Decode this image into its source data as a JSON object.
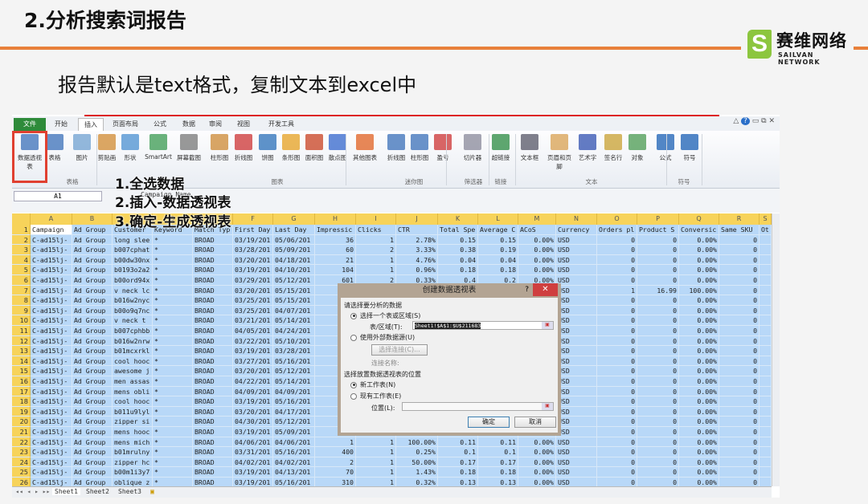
{
  "slide": {
    "title": "2.分析搜索词报告",
    "subtitle": "报告默认是text格式，复制文本到excel中",
    "logo_cn": "赛维网络",
    "logo_en": "SAILVAN NETWORK",
    "accent": "#e8803a"
  },
  "ribbon": {
    "tabs": [
      "文件",
      "开始",
      "插入",
      "页面布局",
      "公式",
      "数据",
      "审阅",
      "视图",
      "开发工具"
    ],
    "buttons": [
      "数据透视表",
      "表格",
      "图片",
      "剪贴画",
      "形状",
      "SmartArt",
      "屏幕截图",
      "柱形图",
      "折线图",
      "饼图",
      "条形图",
      "面积图",
      "散点图",
      "其他图表",
      "折线图",
      "柱形图",
      "盈亏",
      "切片器",
      "超链接",
      "文本框",
      "页眉和页脚",
      "艺术字",
      "签名行",
      "对象",
      "公式",
      "符号"
    ],
    "groups": [
      "表格",
      "图表",
      "迷你图",
      "筛选器",
      "链接",
      "文本",
      "符号"
    ]
  },
  "formula": {
    "name_box": "A1",
    "value": "Campaign Name"
  },
  "steps": [
    "1.全选数据",
    "2.插入-数据透视表",
    "3.确定-生成透视表"
  ],
  "columns": [
    "A",
    "B",
    "C",
    "D",
    "E",
    "F",
    "G",
    "H",
    "I",
    "J",
    "K",
    "L",
    "M",
    "N",
    "O",
    "P",
    "Q",
    "R",
    "S"
  ],
  "rows": [
    [
      "Campaign",
      "Ad Group",
      "Customer",
      "Keyword",
      "Match Typ",
      "First Day",
      "Last Day",
      "Impressic",
      "Clicks",
      "CTR",
      "Total Spe",
      "Average C",
      "ACoS",
      "Currency",
      "Orders pl",
      "Product S",
      "Conversic",
      "Same SKU",
      "Ot"
    ],
    [
      "C-ad15lj-",
      "Ad Group",
      "long slee",
      "*",
      "BROAD",
      "03/19/201",
      "05/06/201",
      "36",
      "1",
      "2.78%",
      "0.15",
      "0.15",
      "0.00%",
      "USD",
      "0",
      "0",
      "0.00%",
      "0",
      ""
    ],
    [
      "C-ad15lj-",
      "Ad Group",
      "b007cphat",
      "*",
      "BROAD",
      "03/28/201",
      "05/09/201",
      "60",
      "2",
      "3.33%",
      "0.38",
      "0.19",
      "0.00%",
      "USD",
      "0",
      "0",
      "0.00%",
      "0",
      ""
    ],
    [
      "C-ad15lj-",
      "Ad Group",
      "b00dw30nx",
      "*",
      "BROAD",
      "03/20/201",
      "04/18/201",
      "21",
      "1",
      "4.76%",
      "0.04",
      "0.04",
      "0.00%",
      "USD",
      "0",
      "0",
      "0.00%",
      "0",
      ""
    ],
    [
      "C-ad15lj-",
      "Ad Group",
      "b0193o2a2",
      "*",
      "BROAD",
      "03/19/201",
      "04/10/201",
      "104",
      "1",
      "0.96%",
      "0.18",
      "0.18",
      "0.00%",
      "USD",
      "0",
      "0",
      "0.00%",
      "0",
      ""
    ],
    [
      "C-ad15lj-",
      "Ad Group",
      "b00ord94x",
      "*",
      "BROAD",
      "03/29/201",
      "05/12/201",
      "601",
      "2",
      "0.33%",
      "0.4",
      "0.2",
      "0.00%",
      "USD",
      "0",
      "0",
      "0.00%",
      "0",
      ""
    ],
    [
      "C-ad15lj-",
      "Ad Group",
      "v neck lc",
      "*",
      "BROAD",
      "03/20/201",
      "05/15/201",
      "",
      "",
      "",
      "",
      "",
      "",
      "USD",
      "1",
      "16.99",
      "100.00%",
      "0",
      ""
    ],
    [
      "C-ad15lj-",
      "Ad Group",
      "b016w2nyc",
      "*",
      "BROAD",
      "03/25/201",
      "05/15/201",
      "",
      "",
      "",
      "",
      "",
      "",
      "USD",
      "0",
      "0",
      "0.00%",
      "0",
      ""
    ],
    [
      "C-ad15lj-",
      "Ad Group",
      "b00o9q7nc",
      "*",
      "BROAD",
      "03/25/201",
      "04/07/201",
      "",
      "",
      "",
      "",
      "",
      "",
      "USD",
      "0",
      "0",
      "0.00%",
      "0",
      ""
    ],
    [
      "C-ad15lj-",
      "Ad Group",
      "v neck t",
      "*",
      "BROAD",
      "03/21/201",
      "05/14/201",
      "",
      "",
      "",
      "",
      "",
      "",
      "USD",
      "0",
      "0",
      "0.00%",
      "0",
      ""
    ],
    [
      "C-ad15lj-",
      "Ad Group",
      "b007cphbb",
      "*",
      "BROAD",
      "04/05/201",
      "04/24/201",
      "",
      "",
      "",
      "",
      "",
      "",
      "USD",
      "0",
      "0",
      "0.00%",
      "0",
      ""
    ],
    [
      "C-ad15lj-",
      "Ad Group",
      "b016w2nrw",
      "*",
      "BROAD",
      "03/22/201",
      "05/10/201",
      "",
      "",
      "",
      "",
      "",
      "",
      "USD",
      "0",
      "0",
      "0.00%",
      "0",
      ""
    ],
    [
      "C-ad15lj-",
      "Ad Group",
      "b01mcxrkl",
      "*",
      "BROAD",
      "03/19/201",
      "03/28/201",
      "",
      "",
      "",
      "",
      "",
      "",
      "USD",
      "0",
      "0",
      "0.00%",
      "0",
      ""
    ],
    [
      "C-ad15lj-",
      "Ad Group",
      "cool hooc",
      "*",
      "BROAD",
      "03/27/201",
      "05/16/201",
      "",
      "",
      "",
      "",
      "",
      "",
      "USD",
      "0",
      "0",
      "0.00%",
      "0",
      ""
    ],
    [
      "C-ad15lj-",
      "Ad Group",
      "awesome j",
      "*",
      "BROAD",
      "03/20/201",
      "05/12/201",
      "",
      "",
      "",
      "",
      "",
      "",
      "USD",
      "0",
      "0",
      "0.00%",
      "0",
      ""
    ],
    [
      "C-ad15lj-",
      "Ad Group",
      "men assas",
      "*",
      "BROAD",
      "04/22/201",
      "05/14/201",
      "",
      "",
      "",
      "",
      "",
      "",
      "USD",
      "0",
      "0",
      "0.00%",
      "0",
      ""
    ],
    [
      "C-ad15lj-",
      "Ad Group",
      "mens obli",
      "*",
      "BROAD",
      "04/09/201",
      "04/09/201",
      "",
      "",
      "",
      "",
      "",
      "",
      "USD",
      "0",
      "0",
      "0.00%",
      "0",
      ""
    ],
    [
      "C-ad15lj-",
      "Ad Group",
      "cool hooc",
      "*",
      "BROAD",
      "03/19/201",
      "05/16/201",
      "",
      "",
      "",
      "",
      "",
      "",
      "USD",
      "0",
      "0",
      "0.00%",
      "0",
      ""
    ],
    [
      "C-ad15lj-",
      "Ad Group",
      "b011u9lyl",
      "*",
      "BROAD",
      "03/20/201",
      "04/17/201",
      "",
      "",
      "",
      "",
      "",
      "",
      "USD",
      "0",
      "0",
      "0.00%",
      "0",
      ""
    ],
    [
      "C-ad15lj-",
      "Ad Group",
      "zipper si",
      "*",
      "BROAD",
      "04/30/201",
      "05/12/201",
      "",
      "",
      "",
      "",
      "",
      "",
      "USD",
      "0",
      "0",
      "0.00%",
      "0",
      ""
    ],
    [
      "C-ad15lj-",
      "Ad Group",
      "mens hooc",
      "*",
      "BROAD",
      "03/19/201",
      "05/09/201",
      "",
      "",
      "",
      "",
      "",
      "",
      "USD",
      "0",
      "0",
      "0.00%",
      "0",
      ""
    ],
    [
      "C-ad15lj-",
      "Ad Group",
      "mens mich",
      "*",
      "BROAD",
      "04/06/201",
      "04/06/201",
      "1",
      "1",
      "100.00%",
      "0.11",
      "0.11",
      "0.00%",
      "USD",
      "0",
      "0",
      "0.00%",
      "0",
      ""
    ],
    [
      "C-ad15lj-",
      "Ad Group",
      "b01mrulny",
      "*",
      "BROAD",
      "03/31/201",
      "05/16/201",
      "400",
      "1",
      "0.25%",
      "0.1",
      "0.1",
      "0.00%",
      "USD",
      "0",
      "0",
      "0.00%",
      "0",
      ""
    ],
    [
      "C-ad15lj-",
      "Ad Group",
      "zipper hc",
      "*",
      "BROAD",
      "04/02/201",
      "04/02/201",
      "2",
      "1",
      "50.00%",
      "0.17",
      "0.17",
      "0.00%",
      "USD",
      "0",
      "0",
      "0.00%",
      "0",
      ""
    ],
    [
      "C-ad15lj-",
      "Ad Group",
      "b00m1i3y7",
      "*",
      "BROAD",
      "03/19/201",
      "04/13/201",
      "70",
      "1",
      "1.43%",
      "0.18",
      "0.18",
      "0.00%",
      "USD",
      "0",
      "0",
      "0.00%",
      "0",
      ""
    ],
    [
      "C-ad15lj-",
      "Ad Group",
      "oblique z",
      "*",
      "BROAD",
      "03/19/201",
      "05/16/201",
      "310",
      "1",
      "0.32%",
      "0.13",
      "0.13",
      "0.00%",
      "USD",
      "0",
      "0",
      "0.00%",
      "0",
      ""
    ]
  ],
  "sheets": [
    "Sheet1",
    "Sheet2",
    "Sheet3"
  ],
  "dialog": {
    "title": "创建数据透视表",
    "help": "?",
    "close": "✕",
    "section1": "请选择要分析的数据",
    "opt_range": "选择一个表或区域(S)",
    "range_label": "表/区域(T):",
    "range_value": "Sheet1!$A$1:$U$211683",
    "opt_external": "使用外部数据源(U)",
    "choose_conn": "选择连接(C)...",
    "conn_name": "连接名称:",
    "section2": "选择放置数据透视表的位置",
    "opt_new": "新工作表(N)",
    "opt_existing": "现有工作表(E)",
    "location_label": "位置(L):",
    "ok": "确定",
    "cancel": "取消"
  }
}
